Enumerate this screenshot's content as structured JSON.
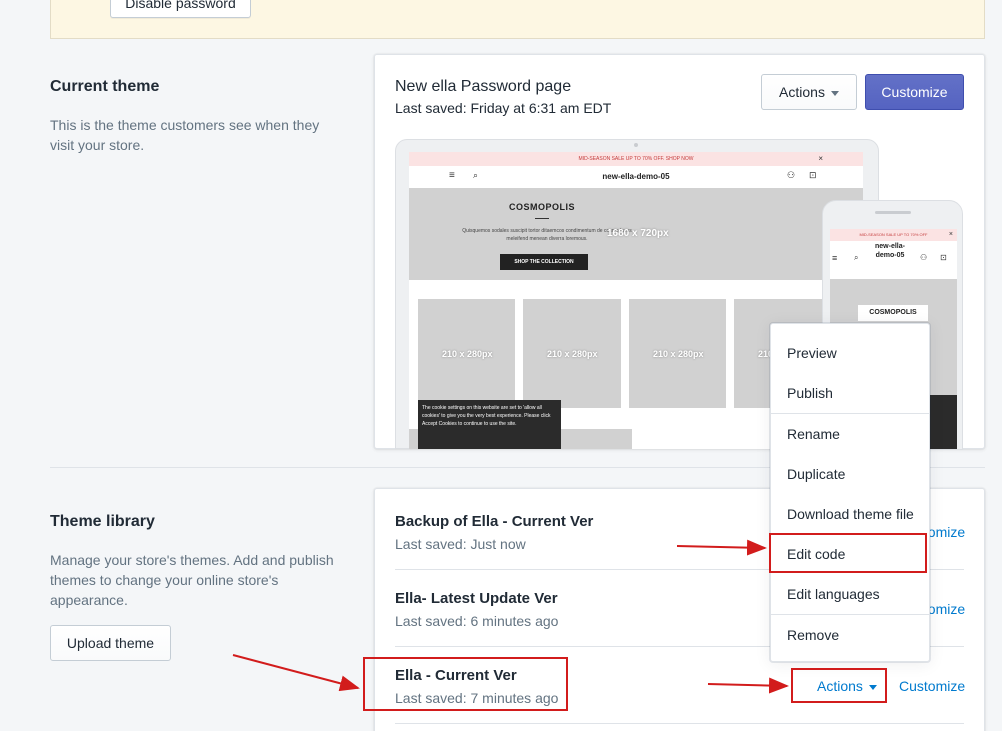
{
  "banner": {
    "disable_label": "Disable password"
  },
  "current_theme": {
    "section_title": "Current theme",
    "section_desc": "This is the theme customers see when they visit your store.",
    "theme_name": "New ella Password page",
    "last_saved": "Last saved: Friday at 6:31 am EDT",
    "actions_label": "Actions",
    "customize_label": "Customize",
    "preview": {
      "announcement": "MID-SEASON SALE UP TO 70% OFF. SHOP NOW",
      "store_name": "new-ella-demo-05",
      "hero_title": "COSMOPOLIS",
      "hero_text": "Quisquemos sodales suscipit tortor ditaemcos condimentum de cosmo lacus meleifend menean diverra loremous.",
      "hero_size": "1680 x 720px",
      "hero_button": "SHOP THE COLLECTION",
      "product_label": "210 x 280px",
      "cookie_text": "The cookie settings on this website are set to 'allow all cookies' to give you the very best experience. Please click Accept Cookies to continue to use the site.",
      "phone_announcement": "MID-SEASON SALE UP TO 70% OFF",
      "phone_store_name": "new-ella-demo-05",
      "phone_hero_title": "COSMOPOLIS"
    }
  },
  "menu": {
    "items": [
      "Preview",
      "Publish",
      "Rename",
      "Duplicate",
      "Download theme file",
      "Edit code",
      "Edit languages",
      "Remove"
    ]
  },
  "library": {
    "section_title": "Theme library",
    "section_desc": "Manage your store's themes. Add and publish themes to change your online store's appearance.",
    "upload_label": "Upload theme",
    "themes": [
      {
        "name": "Backup of Ella - Current Ver",
        "saved": "Last saved: Just now",
        "customize": "Customize"
      },
      {
        "name": "Ella- Latest Update Ver",
        "saved": "Last saved: 6 minutes ago",
        "customize": "Customize"
      },
      {
        "name": "Ella - Current Ver",
        "saved": "Last saved: 7 minutes ago",
        "customize": "Customize",
        "actions": "Actions"
      }
    ]
  },
  "colors": {
    "primary": "#5c6ac4",
    "link": "#007ace",
    "annotation": "#d21c1c"
  }
}
